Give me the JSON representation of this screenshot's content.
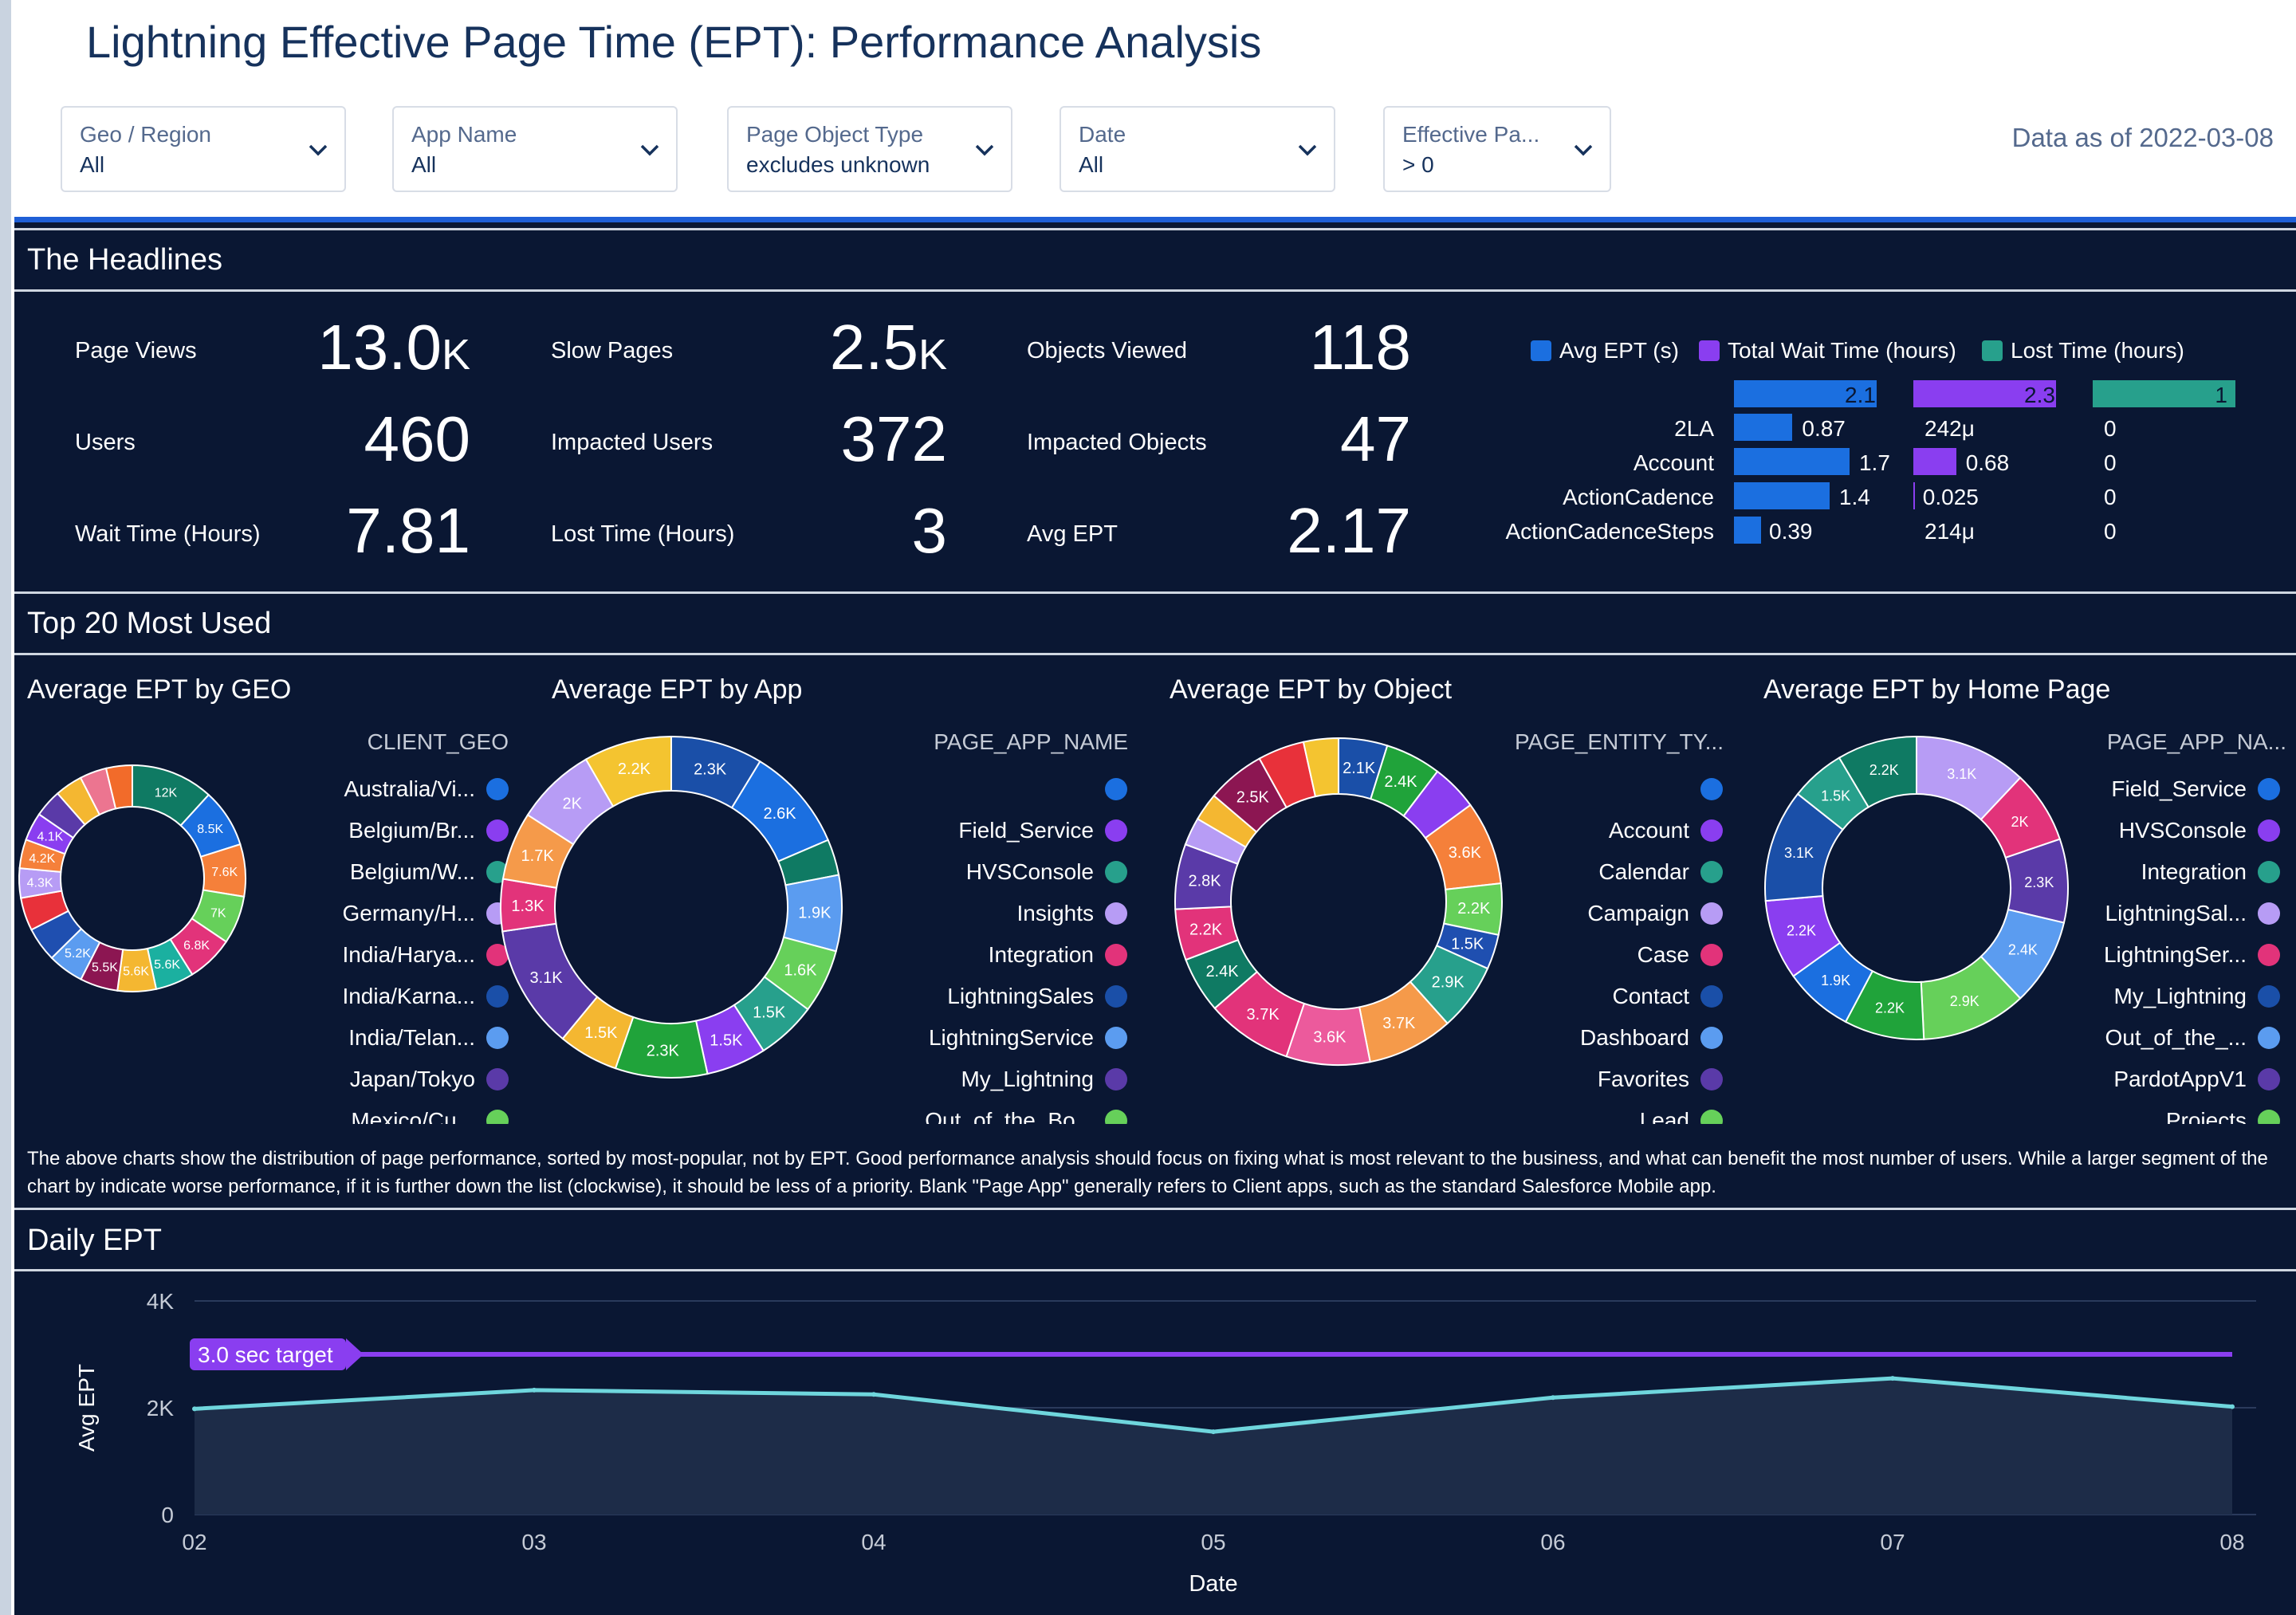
{
  "header": {
    "title": "Lightning Effective Page Time (EPT): Performance  Analysis",
    "data_as_of": "Data as of 2022-03-08"
  },
  "filters": [
    {
      "label": "Geo / Region",
      "value": "All"
    },
    {
      "label": "App Name",
      "value": "All"
    },
    {
      "label": "Page Object Type",
      "value": "excludes unknown"
    },
    {
      "label": "Date",
      "value": "All"
    },
    {
      "label": "Effective Pa...",
      "value": "> 0"
    }
  ],
  "headlines": {
    "section_title": "The Headlines",
    "kpis": [
      {
        "label": "Page Views",
        "value": "13.0",
        "unit": "K"
      },
      {
        "label": "Users",
        "value": "460",
        "unit": ""
      },
      {
        "label": "Wait Time (Hours)",
        "value": "7.81",
        "unit": ""
      },
      {
        "label": "Slow Pages",
        "value": "2.5",
        "unit": "K"
      },
      {
        "label": "Impacted Users",
        "value": "372",
        "unit": ""
      },
      {
        "label": "Lost Time (Hours)",
        "value": "3",
        "unit": ""
      },
      {
        "label": "Objects Viewed",
        "value": "118",
        "unit": ""
      },
      {
        "label": "Impacted Objects",
        "value": "47",
        "unit": ""
      },
      {
        "label": "Avg EPT",
        "value": "2.17",
        "unit": ""
      }
    ],
    "legend": [
      {
        "name": "Avg EPT (s)",
        "color": "#1b6fe0"
      },
      {
        "name": "Total Wait Time (hours)",
        "color": "#8a3ef0"
      },
      {
        "name": "Lost Time (hours)",
        "color": "#27a08c"
      }
    ],
    "table_rows": [
      {
        "label": "",
        "avg": "2.1",
        "wait": "2.3",
        "lost": "1",
        "avg_frac": 1.0,
        "wait_frac": 1.0,
        "lost_frac": 1.0
      },
      {
        "label": "2LA",
        "avg": "0.87",
        "wait": "242μ",
        "lost": "0",
        "avg_frac": 0.41,
        "wait_frac": 0.0,
        "lost_frac": 0.0
      },
      {
        "label": "Account",
        "avg": "1.7",
        "wait": "0.68",
        "lost": "0",
        "avg_frac": 0.81,
        "wait_frac": 0.3,
        "lost_frac": 0.0
      },
      {
        "label": "ActionCadence",
        "avg": "1.4",
        "wait": "0.025",
        "lost": "0",
        "avg_frac": 0.67,
        "wait_frac": 0.01,
        "lost_frac": 0.0
      },
      {
        "label": "ActionCadenceSteps",
        "avg": "0.39",
        "wait": "214μ",
        "lost": "0",
        "avg_frac": 0.19,
        "wait_frac": 0.0,
        "lost_frac": 0.0
      }
    ]
  },
  "top20": {
    "section_title": "Top 20 Most Used",
    "note": "The above charts show the distribution of page performance, sorted by most-popular, not by EPT. Good performance analysis should focus on fixing what is most relevant to the business, and what can benefit the most number of users. While a larger segment of the chart by indicate worse performance, if it is further down the list (clockwise), it should be less of a priority. Blank \"Page App\" generally refers to Client apps, such as the standard Salesforce Mobile app."
  },
  "chart_data": [
    {
      "type": "pie",
      "title": "Average EPT  by GEO",
      "legend_title": "CLIENT_GEO",
      "legend": [
        "Australia/Vi...",
        "Belgium/Br...",
        "Belgium/W...",
        "Germany/H...",
        "India/Harya...",
        "India/Karna...",
        "India/Telan...",
        "Japan/Tokyo",
        "Mexico/Cu..."
      ],
      "slice_labels": [
        "12K",
        "8.5K",
        "7.6K",
        "7K",
        "6.8K",
        "5.6K",
        "5.6K",
        "5.5K",
        "5.2K",
        "",
        "",
        "4.3K",
        "4.2K",
        "4.1K",
        "",
        "",
        "",
        ""
      ],
      "values": [
        12,
        8.5,
        7.6,
        7,
        6.8,
        5.6,
        5.6,
        5.5,
        5.2,
        5,
        4.8,
        4.3,
        4.2,
        4.1,
        4,
        4,
        3.9,
        3.8
      ],
      "colors": [
        "#0f7a63",
        "#1b6fe0",
        "#f5803a",
        "#66d05a",
        "#e2337a",
        "#1bb0a0",
        "#f4b731",
        "#8c1652",
        "#5b9cf0",
        "#1f4fb0",
        "#e8313a",
        "#b79cf5",
        "#f5803a",
        "#8a3ef0",
        "#5a3aa8",
        "#f4b731",
        "#ec7590",
        "#f26b2a"
      ]
    },
    {
      "type": "pie",
      "title": "Average EPT by App",
      "legend_title": "PAGE_APP_NAME",
      "legend": [
        "",
        "Field_Service",
        "HVSConsole",
        "Insights",
        "Integration",
        "LightningSales",
        "LightningService",
        "My_Lightning",
        "Out_of_the_Bo..."
      ],
      "slice_labels": [
        "2.3K",
        "2.6K",
        "",
        "1.9K",
        "1.6K",
        "1.5K",
        "1.5K",
        "2.3K",
        "1.5K",
        "3.1K",
        "1.3K",
        "1.7K",
        "2K",
        "2.2K"
      ],
      "values": [
        2.3,
        2.6,
        0.9,
        1.9,
        1.6,
        1.5,
        1.5,
        2.3,
        1.5,
        3.1,
        1.3,
        1.7,
        2,
        2.2
      ],
      "colors": [
        "#1a4fa8",
        "#1b6fe0",
        "#0f7a63",
        "#5b9cf0",
        "#66d05a",
        "#27a08c",
        "#8a3ef0",
        "#20a33a",
        "#f4b731",
        "#5a3aa8",
        "#e2337a",
        "#f59a4a",
        "#b79cf5",
        "#f4c430"
      ]
    },
    {
      "type": "pie",
      "title": "Average EPT by Object",
      "legend_title": "PAGE_ENTITY_TY...",
      "legend": [
        "",
        "Account",
        "Calendar",
        "Campaign",
        "Case",
        "Contact",
        "Dashboard",
        "Favorites",
        "Lead"
      ],
      "slice_labels": [
        "2.1K",
        "2.4K",
        "",
        "3.6K",
        "2.2K",
        "1.5K",
        "2.9K",
        "3.7K",
        "3.6K",
        "3.7K",
        "2.4K",
        "2.2K",
        "2.8K",
        "",
        "",
        "2.5K",
        "",
        ""
      ],
      "values": [
        2.1,
        2.4,
        2,
        3.6,
        2.2,
        1.5,
        2.9,
        3.7,
        3.6,
        3.7,
        2.4,
        2.2,
        2.8,
        1.2,
        1.2,
        2.5,
        2,
        1.5
      ],
      "colors": [
        "#1a4fa8",
        "#20a33a",
        "#8a3ef0",
        "#f5803a",
        "#66d05a",
        "#1f4fb0",
        "#27a08c",
        "#f59a4a",
        "#ec5a9c",
        "#e2337a",
        "#0f7a63",
        "#e2337a",
        "#5a3aa8",
        "#b79cf5",
        "#f4b731",
        "#8c1652",
        "#e8313a",
        "#f4c430"
      ]
    },
    {
      "type": "pie",
      "title": "Average EPT by Home Page",
      "legend_title": "PAGE_APP_NA...",
      "legend": [
        "Field_Service",
        "HVSConsole",
        "Integration",
        "LightningSal...",
        "LightningSer...",
        "My_Lightning",
        "Out_of_the_...",
        "PardotAppV1",
        "Projects"
      ],
      "slice_labels": [
        "3.1K",
        "2K",
        "2.3K",
        "2.4K",
        "2.9K",
        "2.2K",
        "1.9K",
        "2.2K",
        "3.1K",
        "1.5K",
        "2.2K"
      ],
      "values": [
        3.1,
        2,
        2.3,
        2.4,
        2.9,
        2.2,
        1.9,
        2.2,
        3.1,
        1.5,
        2.2
      ],
      "colors": [
        "#b79cf5",
        "#e2337a",
        "#5a3aa8",
        "#5b9cf0",
        "#66d05a",
        "#20a33a",
        "#1b6fe0",
        "#8a3ef0",
        "#1a4fa8",
        "#27a08c",
        "#0f7a63"
      ]
    },
    {
      "type": "area",
      "title": "Daily EPT",
      "xlabel": "Date",
      "ylabel": "Avg EPT",
      "x": [
        "02",
        "03",
        "04",
        "05",
        "06",
        "07",
        "08"
      ],
      "values": [
        1980,
        2330,
        2250,
        1550,
        2190,
        2550,
        2020
      ],
      "ylim": [
        0,
        4000
      ],
      "yticks": [
        "0",
        "2K",
        "4K"
      ],
      "target": {
        "label": "3.0 sec target",
        "value": 3000
      }
    }
  ],
  "daily": {
    "section_title": "Daily EPT"
  }
}
